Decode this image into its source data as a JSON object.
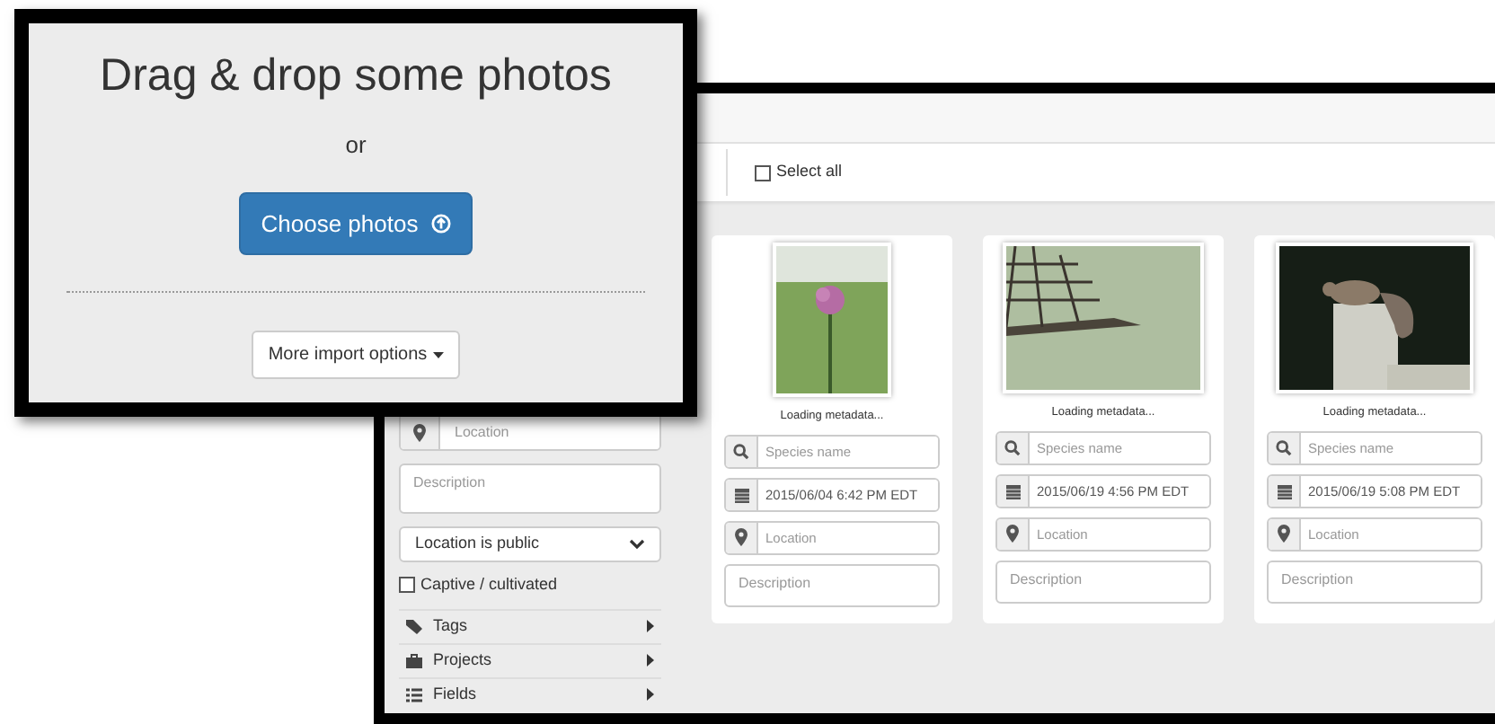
{
  "upload_dialog": {
    "title": "Drag & drop some photos",
    "separator": "or",
    "choose_button": "Choose photos",
    "more_button": "More import options"
  },
  "uploader": {
    "select_all": {
      "label": "Select all",
      "checked": false
    },
    "sidebar": {
      "location_placeholder": "Location",
      "description_placeholder": "Description",
      "visibility": "Location is public",
      "captive": {
        "label": "Captive / cultivated",
        "checked": false
      },
      "sections": [
        {
          "label": "Tags"
        },
        {
          "label": "Projects"
        },
        {
          "label": "Fields"
        }
      ]
    },
    "cards": [
      {
        "status": "Loading metadata...",
        "species_placeholder": "Species name",
        "date": "2015/06/04 6:42 PM EDT",
        "location_placeholder": "Location",
        "description_placeholder": "Description"
      },
      {
        "status": "Loading metadata...",
        "species_placeholder": "Species name",
        "date": "2015/06/19 4:56 PM EDT",
        "location_placeholder": "Location",
        "description_placeholder": "Description"
      },
      {
        "status": "Loading metadata...",
        "species_placeholder": "Species name",
        "date": "2015/06/19 5:08 PM EDT",
        "location_placeholder": "Location",
        "description_placeholder": "Description"
      }
    ]
  }
}
